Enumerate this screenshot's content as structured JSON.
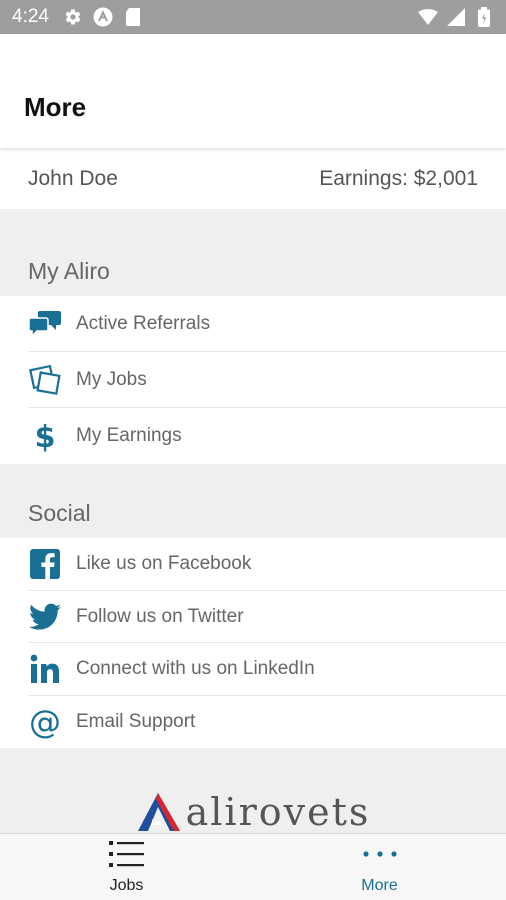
{
  "status_bar": {
    "time": "4:24",
    "icons_left": [
      "gear-icon",
      "a-icon",
      "sd-card-icon"
    ],
    "icons_right": [
      "wifi-icon",
      "signal-icon",
      "battery-icon"
    ]
  },
  "header": {
    "title": "More"
  },
  "user": {
    "name": "John Doe",
    "earnings": "Earnings: $2,001"
  },
  "my_aliro": {
    "title": "My Aliro",
    "items": [
      {
        "label": "Active Referrals",
        "icon": "chat-bubbles-icon"
      },
      {
        "label": "My Jobs",
        "icon": "jobs-icon"
      },
      {
        "label": "My Earnings",
        "icon": "dollar-icon"
      }
    ]
  },
  "social": {
    "title": "Social",
    "items": [
      {
        "label": "Like us on Facebook",
        "icon": "facebook-icon"
      },
      {
        "label": "Follow us on Twitter",
        "icon": "twitter-icon"
      },
      {
        "label": "Connect with us on LinkedIn",
        "icon": "linkedin-icon"
      },
      {
        "label": "Email Support",
        "icon": "at-icon"
      }
    ]
  },
  "logo": {
    "text": "alirovets"
  },
  "bottom_nav": {
    "tabs": [
      {
        "label": "Jobs",
        "icon": "list-icon",
        "active": false
      },
      {
        "label": "More",
        "icon": "more-dots-icon",
        "active": true
      }
    ]
  },
  "colors": {
    "accent": "#1a6f94",
    "logo_red": "#d7262e",
    "logo_blue": "#1f4e9e",
    "status_bar": "#9e9e9e"
  }
}
